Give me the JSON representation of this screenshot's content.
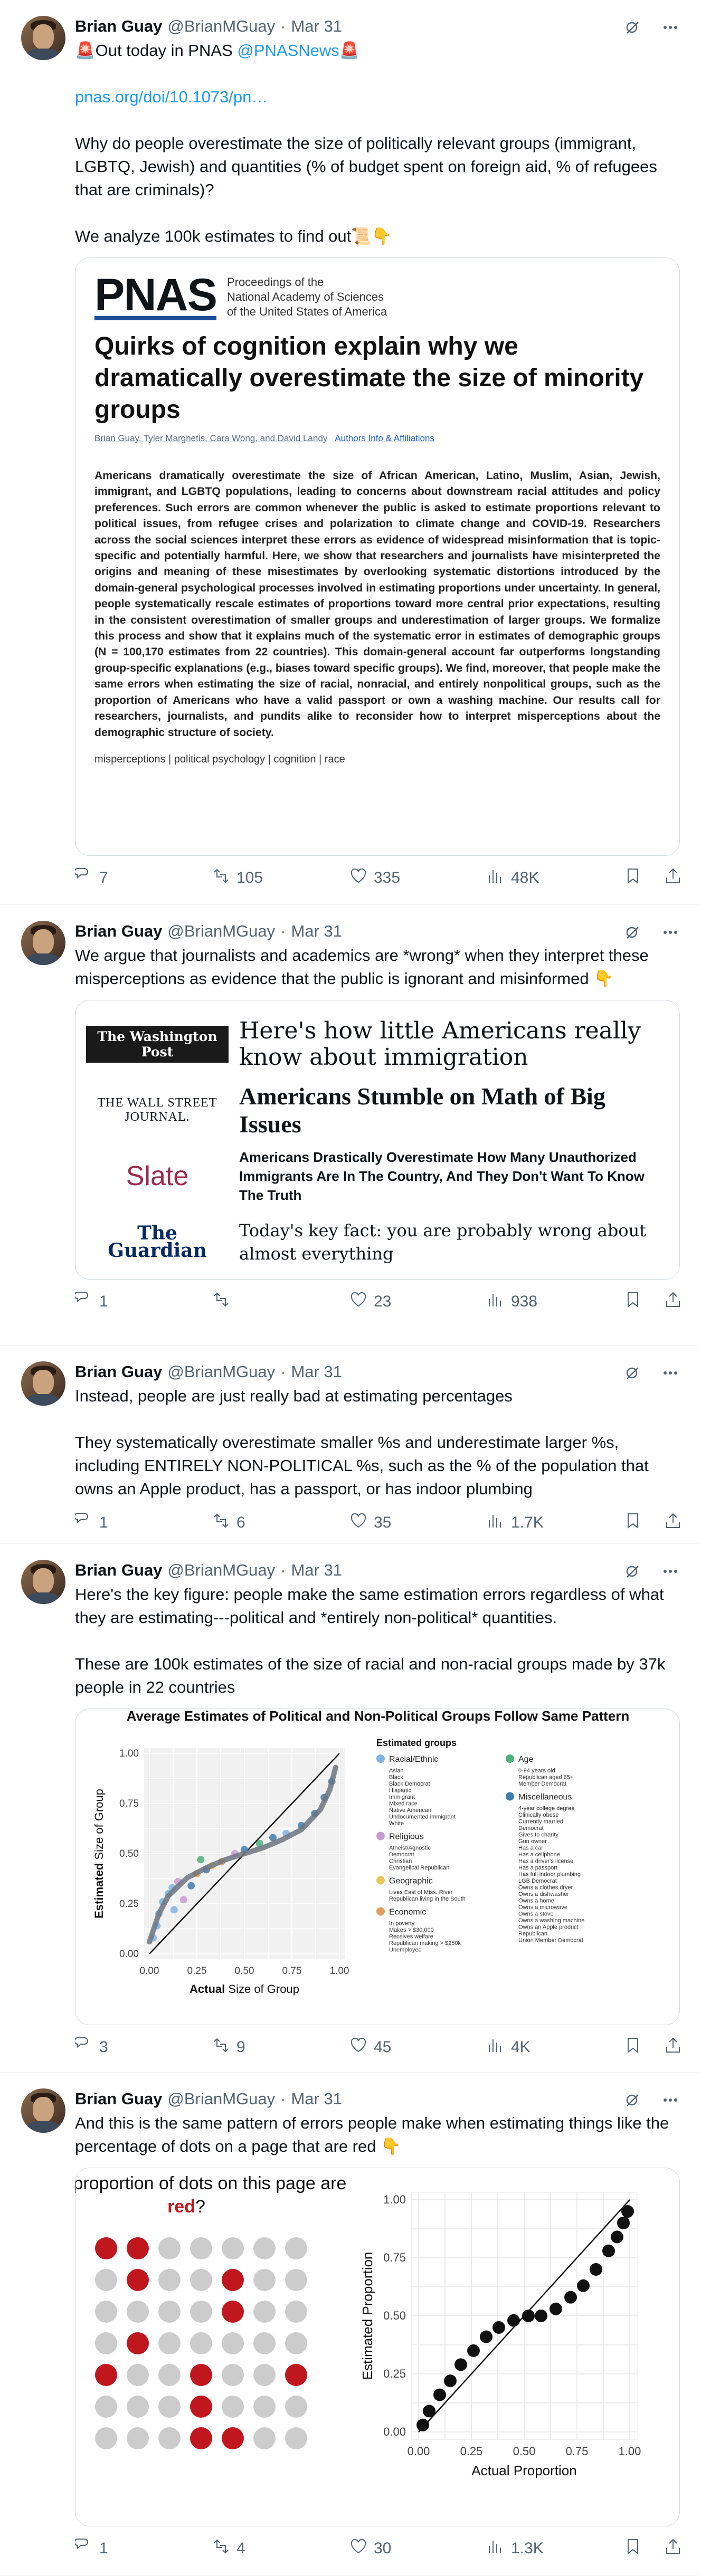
{
  "author": {
    "name": "Brian Guay",
    "handle": "@BrianMGuay",
    "date": "Mar 31",
    "dot": "·"
  },
  "tweets": [
    {
      "text_pre": "🚨Out today in PNAS ",
      "mention": "@PNASNews",
      "text_pre_end": "🚨",
      "link": "pnas.org/doi/10.1073/pn…",
      "text": "Why do people overestimate the size of politically relevant groups (immigrant, LGBTQ, Jewish) and quantities (% of budget spent on foreign aid, % of refugees that are criminals)?\n\nWe analyze 100k estimates to find out📜👇",
      "stats": {
        "replies": "7",
        "retweets": "105",
        "likes": "335",
        "views": "48K"
      }
    },
    {
      "text": "We argue that journalists and academics are *wrong* when they interpret these misperceptions as evidence that the public is ignorant and misinformed 👇",
      "stats": {
        "replies": "1",
        "retweets": "",
        "likes": "23",
        "views": "938"
      }
    },
    {
      "text": "Instead, people are just really bad at estimating percentages\n\nThey systematically overestimate smaller %s and underestimate larger %s, including ENTIRELY NON-POLITICAL %s, such as the % of the population that owns an Apple product, has a passport, or has indoor plumbing",
      "stats": {
        "replies": "1",
        "retweets": "6",
        "likes": "35",
        "views": "1.7K"
      }
    },
    {
      "text": "Here's the key figure: people make the same estimation errors regardless of what they are estimating---political and *entirely non-political* quantities.\n\nThese are 100k estimates of the size of racial and non-racial groups made by 37k people in 22 countries",
      "stats": {
        "replies": "3",
        "retweets": "9",
        "likes": "45",
        "views": "4K"
      }
    },
    {
      "text": "And this is the same pattern of errors people make when estimating things like the percentage of dots on a page that are red 👇",
      "stats": {
        "replies": "1",
        "retweets": "4",
        "likes": "30",
        "views": "1.3K"
      }
    }
  ],
  "pnas_card": {
    "logo": "PNAS",
    "publisher": [
      "Proceedings of the",
      "National Academy of Sciences",
      "of the United States of America"
    ],
    "title": "Quirks of cognition explain why we dramatically overestimate the size of minority groups",
    "authors": "Brian Guay, Tyler Marghetis, Cara Wong, and David Landy",
    "authors_link": "Authors Info & Affiliations",
    "abstract": "Americans dramatically overestimate the size of African American, Latino, Muslim, Asian, Jewish, immigrant, and LGBTQ populations, leading to concerns about downstream racial attitudes and policy preferences. Such errors are common whenever the public is asked to estimate proportions relevant to political issues, from refugee crises and polarization to climate change and COVID-19. Researchers across the social sciences interpret these errors as evidence of widespread misinformation that is topic-specific and potentially harmful. Here, we show that researchers and journalists have misinterpreted the origins and meaning of these misestimates by overlooking systematic distortions introduced by the domain-general psychological processes involved in estimating proportions under uncertainty. In general, people systematically rescale estimates of proportions toward more central prior expectations, resulting in the consistent overestimation of smaller groups and underestimation of larger groups. We formalize this process and show that it explains much of the systematic error in estimates of demographic groups (N = 100,170 estimates from 22 countries). This domain-general account far outperforms longstanding group-specific explanations (e.g., biases toward specific groups). We find, moreover, that people make the same errors when estimating the size of racial, nonracial, and entirely nonpolitical groups, such as the proportion of Americans who have a valid passport or own a washing machine. Our results call for researchers, journalists, and pundits alike to reconsider how to interpret misperceptions about the demographic structure of society.",
    "keywords": "misperceptions  |  political psychology  |  cognition  |  race"
  },
  "headlines": [
    {
      "outlet": "The Washington Post",
      "headline": "Here's how little Americans really know about immigration"
    },
    {
      "outlet": "THE WALL STREET JOURNAL.",
      "headline": "Americans Stumble on Math of Big Issues"
    },
    {
      "outlet": "Slate",
      "headline": "Americans Drastically Overestimate How Many Unauthorized Immigrants Are In The Country, And They Don't Want To Know The Truth"
    },
    {
      "outlet": "The Guardian",
      "headline": "Today's key fact: you are probably wrong about almost everything"
    }
  ],
  "chart_data": [
    {
      "type": "scatter",
      "title": "Average Estimates of Political and Non-Political Groups Follow Same Pattern",
      "xlabel_bold": "Actual",
      "xlabel_rest": " Size of Group",
      "ylabel_bold": "Estimated",
      "ylabel_rest": " Size of Group",
      "xlim": [
        0,
        1
      ],
      "ylim": [
        0,
        1
      ],
      "xticks": [
        "0.00",
        "0.25",
        "0.50",
        "0.75",
        "1.00"
      ],
      "yticks": [
        "0.00",
        "0.25",
        "0.50",
        "0.75",
        "1.00"
      ],
      "legend_title": "Estimated groups",
      "legend_groups": [
        {
          "name": "Racial/Ethnic",
          "color": "#7fb3e0",
          "items": [
            "Asian",
            "Black",
            "Black Democrat",
            "Hispanic",
            "Immigrant",
            "Mixed race",
            "Native American",
            "Undocumented immigrant",
            "White"
          ]
        },
        {
          "name": "Religious",
          "color": "#c79ad6",
          "items": [
            "Atheist/Agnostic",
            "Democrat",
            "Christian",
            "Evangelical Republican"
          ]
        },
        {
          "name": "Geographic",
          "color": "#e8c45a",
          "items": [
            "Lives East of Miss. River",
            "Republican living in the South"
          ]
        },
        {
          "name": "Economic",
          "color": "#e39c5e",
          "items": [
            "In poverty",
            "Makes > $30,000",
            "Receives welfare",
            "Republican making > $250k",
            "Unemployed"
          ]
        },
        {
          "name": "Age",
          "color": "#4fb07a",
          "items": [
            "0-94 years old",
            "Republican aged 65+",
            "Member Democrat"
          ]
        },
        {
          "name": "Miscellaneous",
          "color": "#3f7fb0",
          "items": [
            "4-year college degree",
            "Clinically obese",
            "Currently married",
            "Democrat",
            "Gives to charity",
            "Gun owner",
            "Has a car",
            "Has a cellphone",
            "Has a driver's license",
            "Has a passport",
            "Has full indoor plumbing",
            "LGB Democrat",
            "Owns a clothes dryer",
            "Owns a dishwasher",
            "Owns a home",
            "Owns a microwave",
            "Owns a stove",
            "Owns a washing machine",
            "Owns an Apple product",
            "Republican",
            "Union Member Democrat"
          ]
        }
      ],
      "points": [
        {
          "x": 0.02,
          "y": 0.08,
          "g": 0
        },
        {
          "x": 0.04,
          "y": 0.14,
          "g": 0
        },
        {
          "x": 0.05,
          "y": 0.2,
          "g": 0
        },
        {
          "x": 0.07,
          "y": 0.26,
          "g": 0
        },
        {
          "x": 0.1,
          "y": 0.3,
          "g": 0
        },
        {
          "x": 0.12,
          "y": 0.33,
          "g": 0
        },
        {
          "x": 0.13,
          "y": 0.22,
          "g": 0
        },
        {
          "x": 0.15,
          "y": 0.36,
          "g": 1
        },
        {
          "x": 0.18,
          "y": 0.27,
          "g": 1
        },
        {
          "x": 0.22,
          "y": 0.34,
          "g": 5
        },
        {
          "x": 0.25,
          "y": 0.4,
          "g": 3
        },
        {
          "x": 0.27,
          "y": 0.47,
          "g": 4
        },
        {
          "x": 0.3,
          "y": 0.42,
          "g": 5
        },
        {
          "x": 0.33,
          "y": 0.44,
          "g": 2
        },
        {
          "x": 0.38,
          "y": 0.46,
          "g": 3
        },
        {
          "x": 0.45,
          "y": 0.5,
          "g": 1
        },
        {
          "x": 0.5,
          "y": 0.52,
          "g": 5
        },
        {
          "x": 0.58,
          "y": 0.55,
          "g": 4
        },
        {
          "x": 0.65,
          "y": 0.58,
          "g": 5
        },
        {
          "x": 0.72,
          "y": 0.6,
          "g": 0
        },
        {
          "x": 0.8,
          "y": 0.64,
          "g": 5
        },
        {
          "x": 0.87,
          "y": 0.7,
          "g": 5
        },
        {
          "x": 0.92,
          "y": 0.78,
          "g": 5
        },
        {
          "x": 0.96,
          "y": 0.86,
          "g": 5
        }
      ],
      "curve": [
        {
          "x": 0.0,
          "y": 0.06
        },
        {
          "x": 0.05,
          "y": 0.2
        },
        {
          "x": 0.1,
          "y": 0.29
        },
        {
          "x": 0.2,
          "y": 0.38
        },
        {
          "x": 0.3,
          "y": 0.43
        },
        {
          "x": 0.4,
          "y": 0.47
        },
        {
          "x": 0.5,
          "y": 0.5
        },
        {
          "x": 0.6,
          "y": 0.53
        },
        {
          "x": 0.7,
          "y": 0.57
        },
        {
          "x": 0.8,
          "y": 0.62
        },
        {
          "x": 0.9,
          "y": 0.72
        },
        {
          "x": 0.95,
          "y": 0.82
        },
        {
          "x": 0.98,
          "y": 0.93
        }
      ]
    },
    {
      "type": "scatter",
      "title_pre": "What proportion of dots on this page are ",
      "title_red": "red",
      "title_post": "?",
      "xlabel": "Actual Proportion",
      "ylabel": "Estimated Proportion",
      "xlim": [
        0,
        1
      ],
      "ylim": [
        0,
        1
      ],
      "xticks": [
        "0.00",
        "0.25",
        "0.50",
        "0.75",
        "1.00"
      ],
      "yticks": [
        "0.00",
        "0.25",
        "0.50",
        "0.75",
        "1.00"
      ],
      "dot_grid": [
        [
          1,
          1,
          0,
          0,
          0,
          0,
          0
        ],
        [
          0,
          1,
          0,
          0,
          1,
          0,
          0
        ],
        [
          0,
          0,
          0,
          0,
          1,
          0,
          0
        ],
        [
          0,
          1,
          0,
          0,
          0,
          0,
          0
        ],
        [
          1,
          0,
          0,
          1,
          0,
          0,
          1
        ],
        [
          0,
          0,
          0,
          1,
          0,
          0,
          0
        ],
        [
          0,
          0,
          0,
          1,
          1,
          0,
          0
        ]
      ],
      "points": [
        {
          "x": 0.02,
          "y": 0.03
        },
        {
          "x": 0.05,
          "y": 0.09
        },
        {
          "x": 0.1,
          "y": 0.16
        },
        {
          "x": 0.15,
          "y": 0.22
        },
        {
          "x": 0.2,
          "y": 0.29
        },
        {
          "x": 0.26,
          "y": 0.35
        },
        {
          "x": 0.32,
          "y": 0.41
        },
        {
          "x": 0.38,
          "y": 0.45
        },
        {
          "x": 0.45,
          "y": 0.48
        },
        {
          "x": 0.52,
          "y": 0.5
        },
        {
          "x": 0.58,
          "y": 0.5
        },
        {
          "x": 0.65,
          "y": 0.53
        },
        {
          "x": 0.72,
          "y": 0.58
        },
        {
          "x": 0.78,
          "y": 0.63
        },
        {
          "x": 0.84,
          "y": 0.7
        },
        {
          "x": 0.9,
          "y": 0.78
        },
        {
          "x": 0.94,
          "y": 0.84
        },
        {
          "x": 0.97,
          "y": 0.9
        },
        {
          "x": 0.99,
          "y": 0.95
        }
      ]
    }
  ]
}
